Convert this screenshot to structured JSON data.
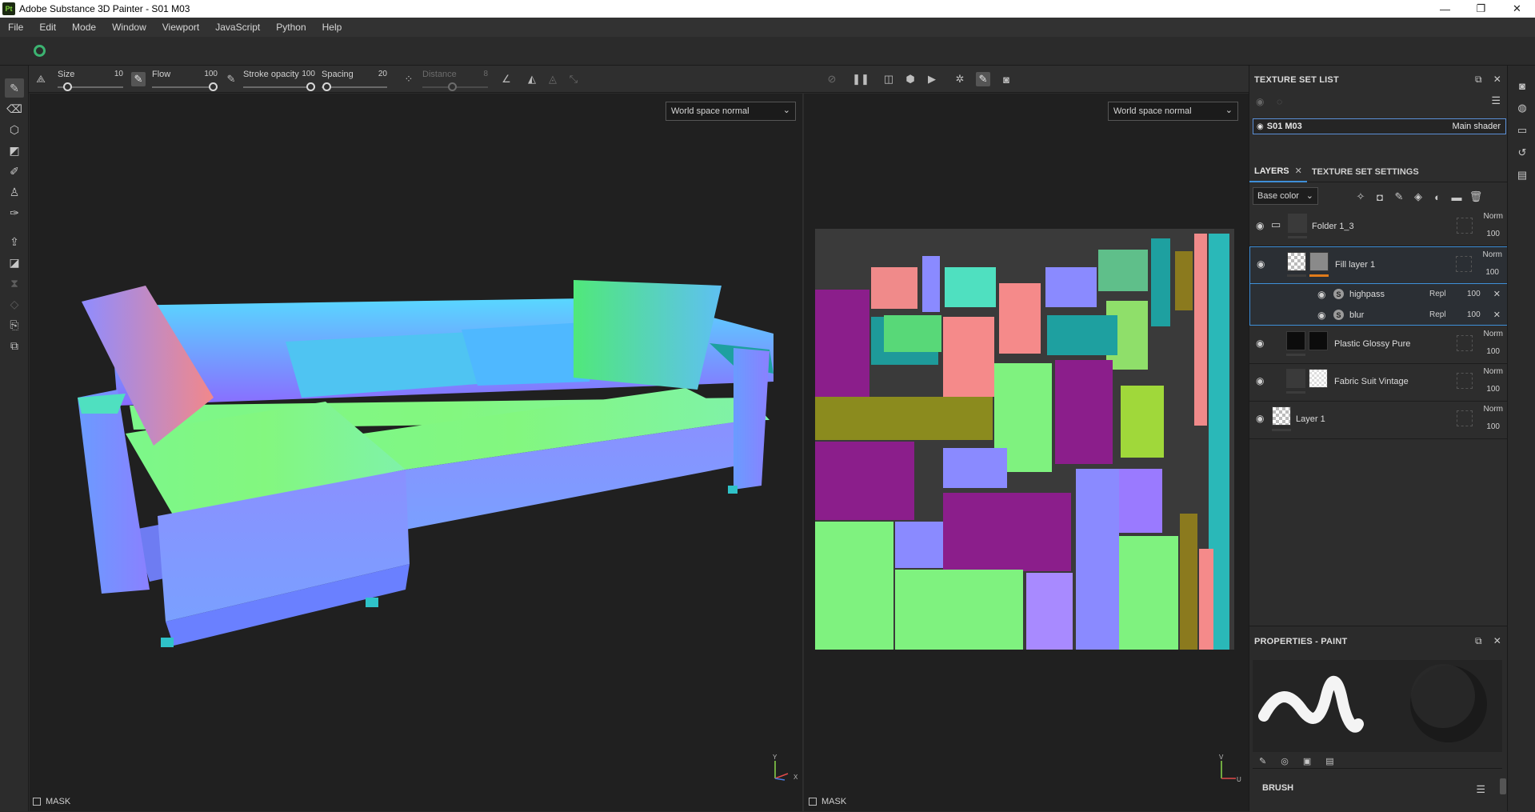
{
  "window": {
    "app_badge": "Pt",
    "title": "Adobe Substance 3D Painter - S01 M03",
    "minimize": "—",
    "maximize": "❐",
    "close": "✕"
  },
  "menu": [
    "File",
    "Edit",
    "Mode",
    "Window",
    "Viewport",
    "JavaScript",
    "Python",
    "Help"
  ],
  "brush_params": {
    "size": {
      "label": "Size",
      "value": "10",
      "fraction": 0.1
    },
    "flow": {
      "label": "Flow",
      "value": "100",
      "fraction": 1.0
    },
    "stroke_opacity": {
      "label": "Stroke opacity",
      "value": "100",
      "fraction": 1.0
    },
    "spacing": {
      "label": "Spacing",
      "value": "20",
      "fraction": 0.02
    },
    "distance": {
      "label": "Distance",
      "value": "8",
      "fraction": 0.45
    }
  },
  "viewport3d": {
    "display_mode": "World space normal",
    "mask_label": "MASK",
    "axis_y": "Y",
    "axis_x": "X"
  },
  "viewport2d": {
    "display_mode": "World space normal",
    "mask_label": "MASK",
    "axis_v": "V",
    "axis_u": "U"
  },
  "texture_set_list": {
    "header": "TEXTURE SET LIST",
    "set_name": "S01 M03",
    "shader": "Main shader"
  },
  "layers_panel": {
    "tab_layers": "LAYERS",
    "tab_settings": "TEXTURE SET SETTINGS",
    "channel": "Base color",
    "layers": [
      {
        "name": "Folder 1_3",
        "blend": "Norm",
        "opacity": "100"
      },
      {
        "name": "Fill layer 1",
        "blend": "Norm",
        "opacity": "100"
      },
      {
        "name": "Plastic Glossy Pure",
        "blend": "Norm",
        "opacity": "100"
      },
      {
        "name": "Fabric Suit Vintage",
        "blend": "Norm",
        "opacity": "100"
      },
      {
        "name": "Layer 1",
        "blend": "Norm",
        "opacity": "100"
      }
    ],
    "effects": [
      {
        "name": "highpass",
        "blend": "Repl",
        "opacity": "100"
      },
      {
        "name": "blur",
        "blend": "Repl",
        "opacity": "100"
      }
    ]
  },
  "properties": {
    "header": "PROPERTIES - PAINT",
    "brush_label": "BRUSH"
  },
  "colors": {
    "accent": "#3e8fd8",
    "fill_layer_bar": "#e07b1a",
    "logo": "#3cb371"
  }
}
